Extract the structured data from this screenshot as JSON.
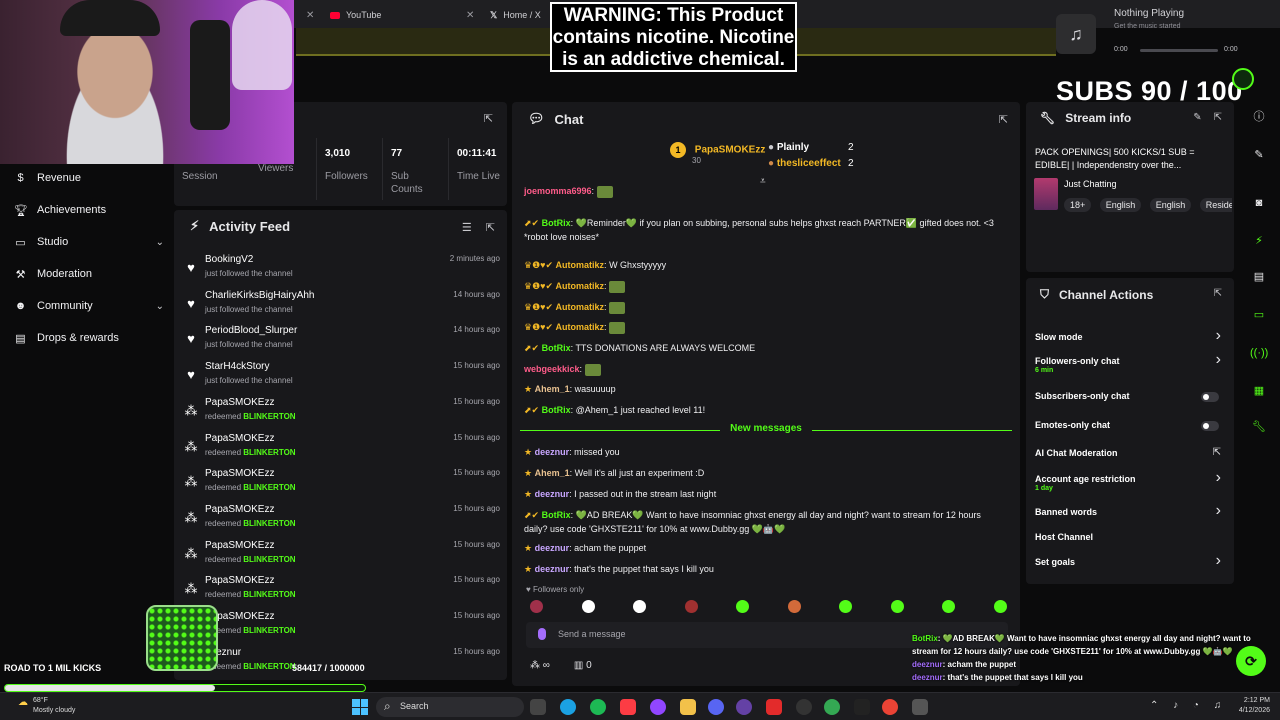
{
  "browser": {
    "tabs": [
      {
        "label": "YouTube",
        "icon": "youtube-icon"
      },
      {
        "label": "Home / X",
        "icon": "x-logo-icon"
      }
    ]
  },
  "warning": {
    "text": "WARNING: This Product contains nicotine. Nicotine is an addictive chemical."
  },
  "music": {
    "title": "Nothing Playing",
    "subtitle": "Get the music started",
    "time_start": "0:00",
    "time_end": "0:00"
  },
  "subs_goal": {
    "text": "SUBS 90 / 100",
    "current": 90,
    "target": 100
  },
  "sidebar": {
    "items": [
      {
        "label": "Revenue",
        "icon": "dollar-icon",
        "has_chevron": false
      },
      {
        "label": "Achievements",
        "icon": "trophy-icon",
        "has_chevron": false
      },
      {
        "label": "Studio",
        "icon": "monitor-icon",
        "has_chevron": true
      },
      {
        "label": "Moderation",
        "icon": "hammer-icon",
        "has_chevron": false
      },
      {
        "label": "Community",
        "icon": "people-icon",
        "has_chevron": true
      },
      {
        "label": "Drops & rewards",
        "icon": "gift-icon",
        "has_chevron": false
      }
    ]
  },
  "stats": [
    {
      "value": "",
      "label": "Session"
    },
    {
      "value": "",
      "label": "Viewers"
    },
    {
      "value": "3,010",
      "label": "Followers"
    },
    {
      "value": "77",
      "label": "Sub Counts"
    },
    {
      "value": "00:11:41",
      "label": "Time Live"
    }
  ],
  "activity": {
    "title": "Activity Feed",
    "items": [
      {
        "name": "BookingV2",
        "action": "just followed the channel",
        "highlight": "",
        "time": "2 minutes ago",
        "icon": "heart-icon"
      },
      {
        "name": "CharlieKirksBigHairyAhh",
        "action": "just followed the channel",
        "highlight": "",
        "time": "14 hours ago",
        "icon": "heart-icon"
      },
      {
        "name": "PeriodBlood_Slurper",
        "action": "just followed the channel",
        "highlight": "",
        "time": "14 hours ago",
        "icon": "heart-icon"
      },
      {
        "name": "StarH4ckStory",
        "action": "just followed the channel",
        "highlight": "",
        "time": "15 hours ago",
        "icon": "heart-icon"
      },
      {
        "name": "PapaSMOKEzz",
        "action": "redeemed",
        "highlight": "BLINKERTON",
        "time": "15 hours ago",
        "icon": "points-icon"
      },
      {
        "name": "PapaSMOKEzz",
        "action": "redeemed",
        "highlight": "BLINKERTON",
        "time": "15 hours ago",
        "icon": "points-icon"
      },
      {
        "name": "PapaSMOKEzz",
        "action": "redeemed",
        "highlight": "BLINKERTON",
        "time": "15 hours ago",
        "icon": "points-icon"
      },
      {
        "name": "PapaSMOKEzz",
        "action": "redeemed",
        "highlight": "BLINKERTON",
        "time": "15 hours ago",
        "icon": "points-icon"
      },
      {
        "name": "PapaSMOKEzz",
        "action": "redeemed",
        "highlight": "BLINKERTON",
        "time": "15 hours ago",
        "icon": "points-icon"
      },
      {
        "name": "PapaSMOKEzz",
        "action": "redeemed",
        "highlight": "BLINKERTON",
        "time": "15 hours ago",
        "icon": "points-icon"
      },
      {
        "name": "PapaSMOKEzz",
        "action": "redeemed",
        "highlight": "BLINKERTON",
        "time": "15 hours ago",
        "icon": "points-icon"
      },
      {
        "name": "deeznur",
        "action": "redeemed",
        "highlight": "BLINKERTON",
        "time": "15 hours ago",
        "icon": "points-icon"
      }
    ]
  },
  "chat": {
    "title": "Chat",
    "leaderboard": [
      {
        "rank": "1",
        "name": "PapaSMOKEzz",
        "value": "30"
      },
      {
        "rank": "",
        "name": "Plainly",
        "value": "2"
      },
      {
        "rank": "",
        "name": "thesliceeffect",
        "value": "2"
      }
    ],
    "messages": [
      {
        "user": "joemomma6996",
        "text": "",
        "color": "#ff5c8a",
        "badges": ""
      },
      {
        "user": "BotRix",
        "text": "💚Reminder💚 if you plan on subbing, personal subs helps ghxst reach PARTNER✅ gifted does not. <3 *robot love noises*",
        "color": "#53fc18",
        "badges": "⬈✔"
      },
      {
        "user": "Automatikz",
        "text": "W Ghxstyyyyy",
        "color": "#f2b825",
        "badges": "♛❶♥✔"
      },
      {
        "user": "Automatikz",
        "text": "",
        "color": "#f2b825",
        "badges": "♛❶♥✔"
      },
      {
        "user": "Automatikz",
        "text": "",
        "color": "#f2b825",
        "badges": "♛❶♥✔"
      },
      {
        "user": "Automatikz",
        "text": "",
        "color": "#f2b825",
        "badges": "♛❶♥✔"
      },
      {
        "user": "BotRix",
        "text": "TTS DONATIONS ARE ALWAYS WELCOME",
        "color": "#53fc18",
        "badges": "⬈✔"
      },
      {
        "user": "webgeekkick",
        "text": "",
        "color": "#ff5c8a",
        "badges": ""
      },
      {
        "user": "Ahem_1",
        "text": "wasuuuup",
        "color": "#e8c190",
        "badges": "★"
      },
      {
        "user": "BotRix",
        "text": "@Ahem_1 just reached level 11!",
        "color": "#53fc18",
        "badges": "⬈✔"
      },
      {
        "user": "deeznur",
        "text": "missed you",
        "color": "#c8a6ff",
        "badges": "★"
      },
      {
        "user": "Ahem_1",
        "text": "Well it's all just an experiment :D",
        "color": "#e8c190",
        "badges": "★"
      },
      {
        "user": "deeznur",
        "text": "I passed out in the stream last night",
        "color": "#c8a6ff",
        "badges": "★"
      },
      {
        "user": "BotRix",
        "text": "💚AD BREAK💚 Want to have insomniac ghxst energy all day and night? want to stream for 12 hours daily? use code 'GHXSTE211' for 10% at www.Dubby.gg 💚🤖💚",
        "color": "#53fc18",
        "badges": "⬈✔"
      },
      {
        "user": "deeznur",
        "text": "acham the puppet",
        "color": "#c8a6ff",
        "badges": "★"
      },
      {
        "user": "deeznur",
        "text": "that's the puppet that says I kill you",
        "color": "#c8a6ff",
        "badges": "★"
      }
    ],
    "new_messages_label": "New messages",
    "followers_only": "Followers only",
    "input_placeholder": "Send a message",
    "footer_points": "∞",
    "footer_count": "0"
  },
  "stream_info": {
    "title_label": "Stream info",
    "stream_title": "PACK OPENINGS| 500 KICKS/1 SUB = EDIBLE| | Independenstry over the...",
    "category": "Just Chatting",
    "tags": [
      "18+",
      "English",
      "English",
      "Reside"
    ]
  },
  "channel_actions": {
    "title": "Channel Actions",
    "items": [
      {
        "label": "Slow mode",
        "sub": "",
        "control": "chevron"
      },
      {
        "label": "Followers-only chat",
        "sub": "6 min",
        "control": "chevron"
      },
      {
        "label": "Subscribers-only chat",
        "sub": "",
        "control": "toggle"
      },
      {
        "label": "Emotes-only chat",
        "sub": "",
        "control": "toggle"
      },
      {
        "label": "AI Chat Moderation",
        "sub": "",
        "control": "external"
      },
      {
        "label": "Account age restriction",
        "sub": "1 day",
        "control": "chevron"
      },
      {
        "label": "Banned words",
        "sub": "",
        "control": "chevron"
      },
      {
        "label": "Host Channel",
        "sub": "",
        "control": "none"
      },
      {
        "label": "Set goals",
        "sub": "",
        "control": "chevron"
      }
    ]
  },
  "road_goal": {
    "label": "ROAD TO 1 MIL KICKS",
    "count": "584417 / 1000000",
    "progress": 0.584
  },
  "overlay_chat": [
    {
      "user": "BotRix",
      "text": ": 💚AD BREAK💚 Want to have insomniac ghxst energy all day and night? want to stream for 12 hours daily? use code 'GHXSTE211' for 10% at www.Dubby.gg 💚🤖💚"
    },
    {
      "user": "deeznur",
      "text": ": acham the puppet"
    },
    {
      "user": "deeznur",
      "text": ": that's the puppet that says I kill you"
    }
  ],
  "taskbar": {
    "weather_temp": "68°F",
    "weather_desc": "Mostly cloudy",
    "search_label": "Search",
    "time": "2:12 PM",
    "date": "4/12/2026"
  },
  "colors": {
    "kick_green": "#53fc18",
    "panel": "#18181b",
    "bg": "#0b0b0c"
  }
}
